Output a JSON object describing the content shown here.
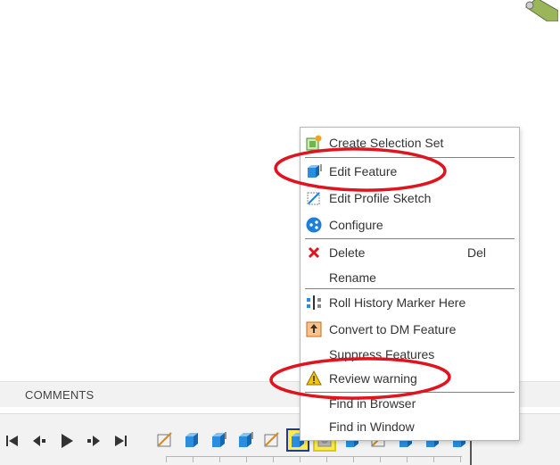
{
  "comments": {
    "label": "COMMENTS"
  },
  "context_menu": {
    "items": [
      {
        "key": "create_selection_set",
        "label": "Create Selection Set",
        "icon": "selection-set-icon"
      },
      {
        "key": "edit_feature",
        "label": "Edit Feature",
        "icon": "edit-feature-icon"
      },
      {
        "key": "edit_profile_sketch",
        "label": "Edit Profile Sketch",
        "icon": "profile-sketch-icon"
      },
      {
        "key": "configure",
        "label": "Configure",
        "icon": "configure-icon"
      },
      {
        "key": "delete",
        "label": "Delete",
        "shortcut": "Del",
        "icon": "delete-icon"
      },
      {
        "key": "rename",
        "label": "Rename"
      },
      {
        "key": "roll_history",
        "label": "Roll History Marker Here",
        "icon": "roll-history-icon"
      },
      {
        "key": "convert_dm",
        "label": "Convert to DM Feature",
        "icon": "convert-dm-icon"
      },
      {
        "key": "suppress",
        "label": "Suppress Features"
      },
      {
        "key": "review_warning",
        "label": "Review warning",
        "icon": "warning-icon"
      },
      {
        "key": "find_browser",
        "label": "Find in Browser"
      },
      {
        "key": "find_window",
        "label": "Find in Window"
      }
    ]
  },
  "timeline": {
    "controls": [
      "skip-to-start-icon",
      "step-back-icon",
      "play-icon",
      "step-forward-icon",
      "skip-to-end-icon"
    ],
    "features": [
      "sketch",
      "extrude",
      "extrude",
      "extrude",
      "sketch",
      "extrude-selected",
      "combine-selected",
      "extrude",
      "sketch",
      "extrude",
      "extrude",
      "extrude"
    ]
  },
  "colors": {
    "annotation": "#e0141e",
    "selection": "#ffe94d",
    "accent": "#1e7fd8"
  }
}
